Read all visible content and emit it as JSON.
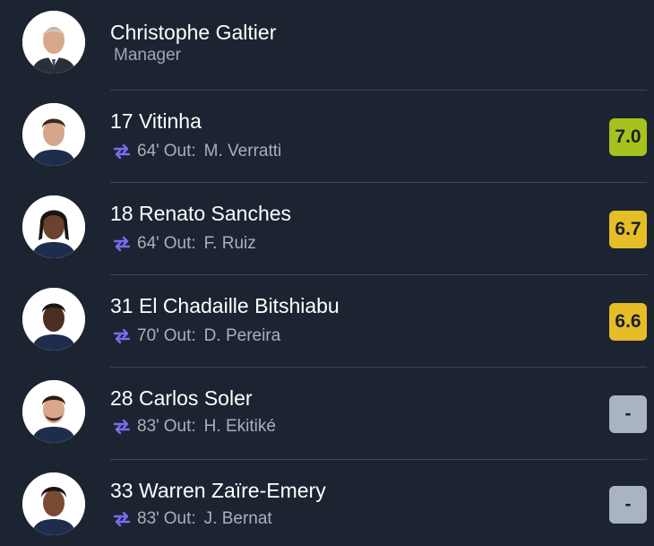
{
  "manager": {
    "name": "Christophe Galtier",
    "role": "Manager"
  },
  "players": [
    {
      "number": "17",
      "name": "Vitinha",
      "title": "17 Vitinha",
      "minute": "64'",
      "out_label": "Out:",
      "out_player": "M. Verratti",
      "rating": "7.0",
      "rating_color": "#a6c21d"
    },
    {
      "number": "18",
      "name": "Renato Sanches",
      "title": "18 Renato Sanches",
      "minute": "64'",
      "out_label": "Out:",
      "out_player": "F. Ruiz",
      "rating": "6.7",
      "rating_color": "#e5bd27"
    },
    {
      "number": "31",
      "name": "El Chadaille Bitshiabu",
      "title": "31 El Chadaille Bitshiabu",
      "minute": "70'",
      "out_label": "Out:",
      "out_player": "D. Pereira",
      "rating": "6.6",
      "rating_color": "#e5bd27"
    },
    {
      "number": "28",
      "name": "Carlos Soler",
      "title": "28 Carlos Soler",
      "minute": "83'",
      "out_label": "Out:",
      "out_player": "H. Ekitiké",
      "rating": "-",
      "rating_color": "#a9b3c4"
    },
    {
      "number": "33",
      "name": "Warren Zaïre-Emery",
      "title": "33 Warren Zaïre-Emery",
      "minute": "83'",
      "out_label": "Out:",
      "out_player": "J. Bernat",
      "rating": "-",
      "rating_color": "#a9b3c4"
    }
  ],
  "icons": {
    "substitution": "swap-arrows-icon",
    "avatar": "player-avatar-icon"
  },
  "colors": {
    "background": "#1c2431",
    "substitution_icon": "#7b6bf0",
    "secondary_text": "#a8b0bd"
  }
}
